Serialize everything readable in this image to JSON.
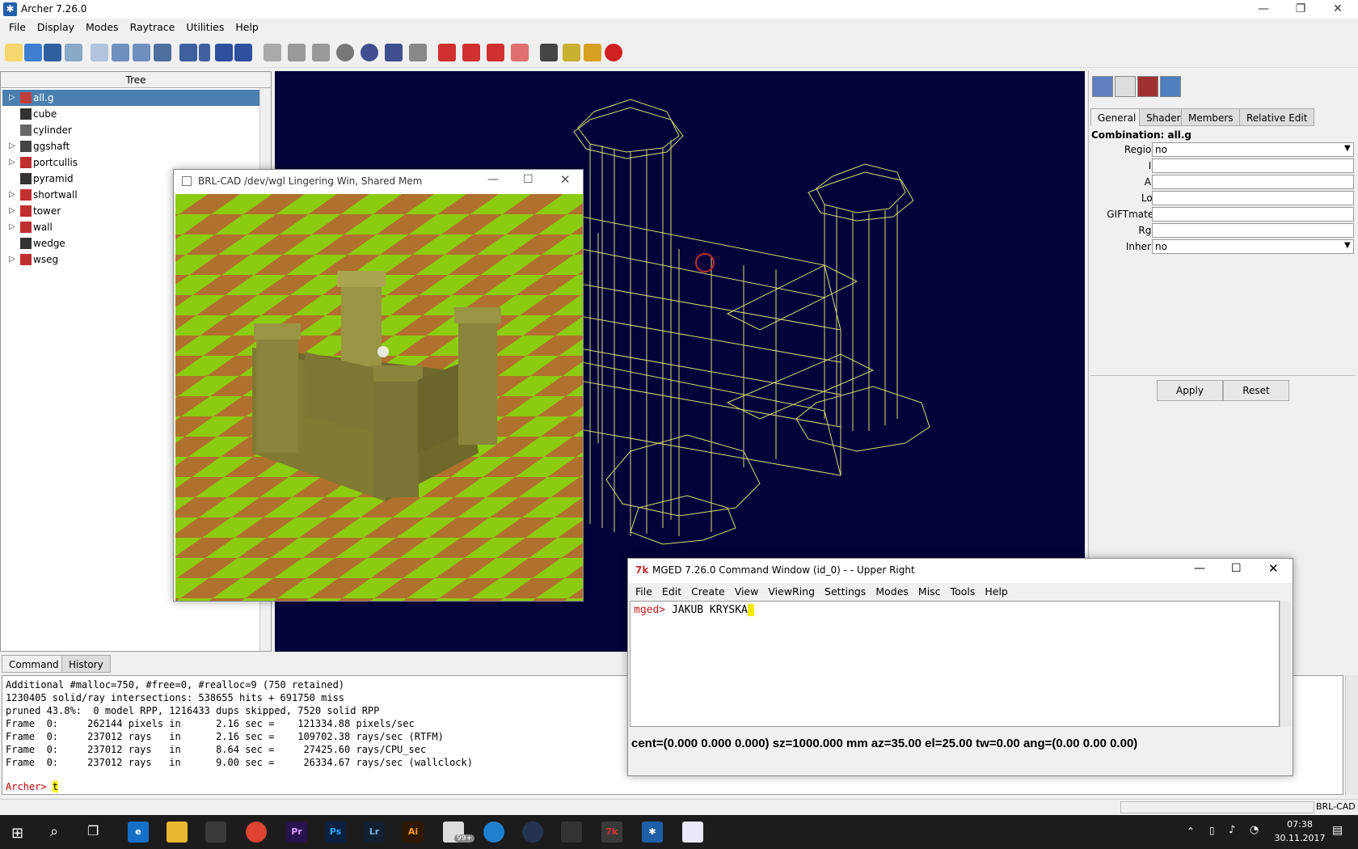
{
  "window": {
    "title": "Archer 7.26.0",
    "minimize": "—",
    "maximize": "❐",
    "close": "✕"
  },
  "menu": [
    "File",
    "Display",
    "Modes",
    "Raytrace",
    "Utilities",
    "Help"
  ],
  "tree": {
    "header": "Tree",
    "items": [
      {
        "label": "all.g",
        "expandable": true,
        "selected": true,
        "icon_color": "#c04040"
      },
      {
        "label": "cube",
        "expandable": false,
        "selected": false,
        "icon_color": "#333333"
      },
      {
        "label": "cylinder",
        "expandable": false,
        "selected": false,
        "icon_color": "#666666"
      },
      {
        "label": "ggshaft",
        "expandable": true,
        "selected": false,
        "icon_color": "#444444"
      },
      {
        "label": "portcullis",
        "expandable": true,
        "selected": false,
        "icon_color": "#c03030"
      },
      {
        "label": "pyramid",
        "expandable": false,
        "selected": false,
        "icon_color": "#333333"
      },
      {
        "label": "shortwall",
        "expandable": true,
        "selected": false,
        "icon_color": "#c03030"
      },
      {
        "label": "tower",
        "expandable": true,
        "selected": false,
        "icon_color": "#c03030"
      },
      {
        "label": "wall",
        "expandable": true,
        "selected": false,
        "icon_color": "#c03030"
      },
      {
        "label": "wedge",
        "expandable": false,
        "selected": false,
        "icon_color": "#333333"
      },
      {
        "label": "wseg",
        "expandable": true,
        "selected": false,
        "icon_color": "#c03030"
      }
    ]
  },
  "props": {
    "tabs": [
      "General",
      "Shader",
      "Members",
      "Relative Edit"
    ],
    "combination_label": "Combination: all.g",
    "fields": [
      {
        "label": "Region:",
        "value": "no",
        "dropdown": true
      },
      {
        "label": "Id:",
        "value": ""
      },
      {
        "label": "Air:",
        "value": ""
      },
      {
        "label": "Los:",
        "value": ""
      },
      {
        "label": "GIFTmater:",
        "value": ""
      },
      {
        "label": "Rgb:",
        "value": ""
      },
      {
        "label": "Inherit:",
        "value": "no",
        "dropdown": true
      }
    ],
    "apply": "Apply",
    "reset": "Reset"
  },
  "console": {
    "tabs": [
      "Command",
      "History"
    ],
    "lines": [
      "Additional #malloc=750, #free=0, #realloc=9 (750 retained)",
      "1230405 solid/ray intersections: 538655 hits + 691750 miss",
      "pruned 43.8%:  0 model RPP, 1216433 dups skipped, 7520 solid RPP",
      "Frame  0:     262144 pixels in      2.16 sec =    121334.88 pixels/sec",
      "Frame  0:     237012 rays   in      2.16 sec =    109702.38 rays/sec (RTFM)",
      "Frame  0:     237012 rays   in      8.64 sec =     27425.60 rays/CPU_sec",
      "Frame  0:     237012 rays   in      9.00 sec =     26334.67 rays/sec (wallclock)"
    ],
    "prompt": "Archer> ",
    "input": "t"
  },
  "statusbar": {
    "right": "BRL-CAD"
  },
  "render_window": {
    "title": "BRL-CAD /dev/wgl Lingering Win, Shared Mem"
  },
  "mged": {
    "title": "MGED 7.26.0 Command Window (id_0) -  - Upper Right",
    "menu": [
      "File",
      "Edit",
      "Create",
      "View",
      "ViewRing",
      "Settings",
      "Modes",
      "Misc",
      "Tools",
      "Help"
    ],
    "prompt": "mged> ",
    "input": "JAKUB KRYSKA",
    "status": "cent=(0.000 0.000 0.000) sz=1000.000  mm  az=35.00  el=25.00  tw=0.00  ang=(0.00 0.00 0.00)"
  },
  "taskbar": {
    "time": "07:38",
    "date": "30.11.2017",
    "badge": "99+"
  }
}
